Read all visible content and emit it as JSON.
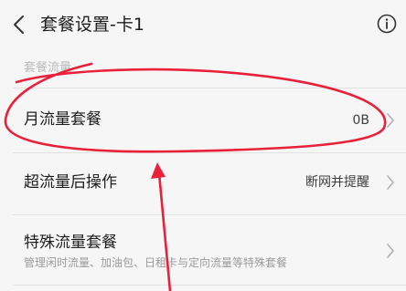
{
  "header": {
    "back_icon": "chevron-left-icon",
    "title": "套餐设置-卡1",
    "info_icon": "info-icon"
  },
  "section": {
    "title": "套餐流量"
  },
  "rows": [
    {
      "label": "月流量套餐",
      "value": "0B",
      "chevron": "chevron-right-icon"
    },
    {
      "label": "超流量后操作",
      "value": "断网并提醒",
      "chevron": "chevron-right-icon"
    },
    {
      "label": "特殊流量套餐",
      "subtitle": "管理闲时流量、加油包、日租卡与定向流量等特殊套餐",
      "chevron": "chevron-right-icon"
    }
  ],
  "colors": {
    "background": "#f6f6f6",
    "annotation": "#e8203a",
    "divider": "#e2e2e2"
  }
}
